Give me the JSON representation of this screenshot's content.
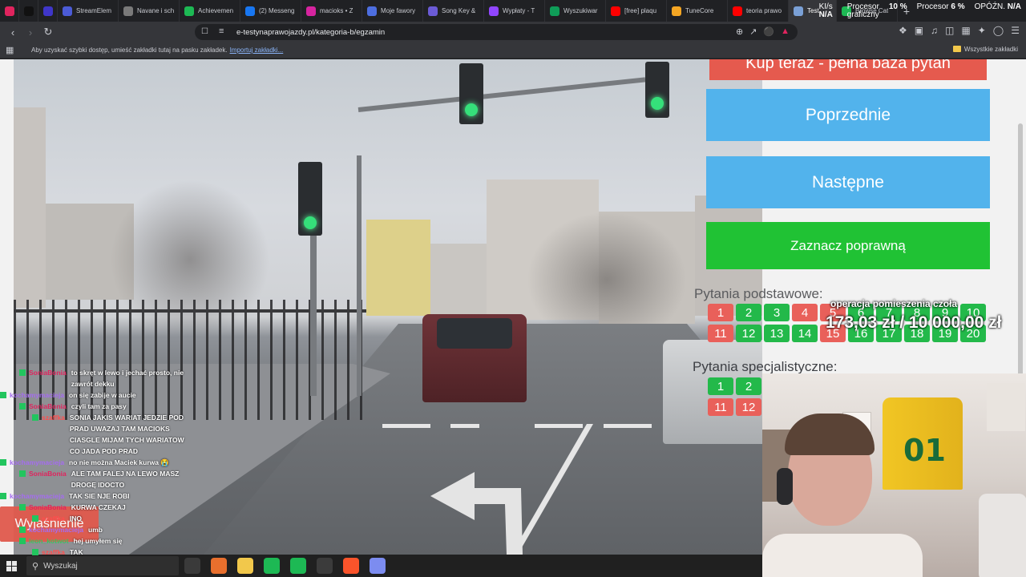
{
  "browser": {
    "tabs": [
      {
        "label": "",
        "icon": "app-red-icon",
        "color": "#e0245e",
        "pinned": true
      },
      {
        "label": "",
        "icon": "tiktok-icon",
        "color": "#111111",
        "pinned": true
      },
      {
        "label": "",
        "icon": "blue-square-icon",
        "color": "#3f36c9",
        "pinned": true
      },
      {
        "label": "StreamElem",
        "icon": "streamelements-icon",
        "color": "#4b5bd6"
      },
      {
        "label": "Navane i sch",
        "icon": "gear-icon",
        "color": "#7a7a7a"
      },
      {
        "label": "Achievemen",
        "icon": "k-logo-icon",
        "color": "#1db954"
      },
      {
        "label": "(2) Messeng",
        "icon": "facebook-icon",
        "color": "#1877f2"
      },
      {
        "label": "macioks • Z",
        "icon": "instagram-icon",
        "color": "#d6249f"
      },
      {
        "label": "Moje fawory",
        "icon": "bookmark-star-icon",
        "color": "#4d6ee0"
      },
      {
        "label": "Song Key &",
        "icon": "music-note-icon",
        "color": "#6b5bd6"
      },
      {
        "label": "Wypłaty - T",
        "icon": "twitch-icon",
        "color": "#9146ff"
      },
      {
        "label": "Wyszukiwar",
        "icon": "sheet-icon",
        "color": "#0f9d58"
      },
      {
        "label": "[free] plaqu",
        "icon": "youtube-icon",
        "color": "#ff0000"
      },
      {
        "label": "TuneCore",
        "icon": "tunecore-icon",
        "color": "#f5a623"
      },
      {
        "label": "teoria prawo",
        "icon": "youtube-icon",
        "color": "#ff0000"
      },
      {
        "label": "Test",
        "icon": "site-icon",
        "color": "#7aa0d6",
        "active": true
      },
      {
        "label": "Browse Cat",
        "icon": "k-logo-icon",
        "color": "#1db954"
      }
    ],
    "new_tab": "+",
    "hw": {
      "ki_label": "KI/s",
      "ki_value": "N/A",
      "gpu_label": "Procesor graficzny",
      "gpu_value": "10 %",
      "cpu_label": "Procesor",
      "cpu_value": "6 %",
      "lat_label": "OPÓŹN.",
      "lat_value": "N/A"
    },
    "url": "e-testynaprawojazdy.pl/kategoria-b/egzamin",
    "bookmarks_hint": "Aby uzyskać szybki dostęp, umieść zakładki tutaj na pasku zakładek.",
    "bookmarks_link": "Importuj zakładki...",
    "all_bookmarks": "Wszystkie zakładki"
  },
  "page": {
    "buy_label": "Kup teraz - pełna baza pytań",
    "prev_label": "Poprzednie",
    "next_label": "Następne",
    "mark_label": "Zaznacz poprawną",
    "basic_title": "Pytania podstawowe:",
    "basic_numbers": [
      {
        "n": "1",
        "status": "wrong"
      },
      {
        "n": "2",
        "status": "correct"
      },
      {
        "n": "3",
        "status": "correct"
      },
      {
        "n": "4",
        "status": "wrong"
      },
      {
        "n": "5",
        "status": "wrong"
      },
      {
        "n": "6",
        "status": "correct"
      },
      {
        "n": "7",
        "status": "correct"
      },
      {
        "n": "8",
        "status": "correct"
      },
      {
        "n": "9",
        "status": "correct"
      },
      {
        "n": "10",
        "status": "correct"
      },
      {
        "n": "11",
        "status": "wrong"
      },
      {
        "n": "12",
        "status": "correct"
      },
      {
        "n": "13",
        "status": "correct"
      },
      {
        "n": "14",
        "status": "correct"
      },
      {
        "n": "15",
        "status": "wrong"
      },
      {
        "n": "16",
        "status": "correct"
      },
      {
        "n": "17",
        "status": "correct"
      },
      {
        "n": "18",
        "status": "correct"
      },
      {
        "n": "19",
        "status": "correct"
      },
      {
        "n": "20",
        "status": "correct"
      }
    ],
    "special_title": "Pytania specjalistyczne:",
    "special_numbers": [
      {
        "n": "1",
        "status": "correct"
      },
      {
        "n": "2",
        "status": "correct"
      },
      {
        "n": "11",
        "status": "wrong"
      },
      {
        "n": "12",
        "status": "wrong"
      }
    ],
    "explain_label": "Wyjaśnienie"
  },
  "overlay": {
    "donation_title": "operacja pomieszenia czoła",
    "donation_amount": "173,03 zł / 10 000,00 zł",
    "chat": [
      {
        "user": "SoniaBonia",
        "color": "#e0245e",
        "msg": "to skręt w lewo i jechać prosto, nie\nzawrót dekku"
      },
      {
        "user": "kochamymacieja",
        "color": "#a56cf0",
        "msg": "on się zabije w aucie"
      },
      {
        "user": "SoniaBonia",
        "color": "#e0245e",
        "msg": "czyli tam za pasy"
      },
      {
        "user": "szaffka",
        "color": "#ff4d4d",
        "msg": "SONIA JAKIS WARIAT JEDZIE POD\nPRAD UWAZAJ TAM MACIOKS\nCIASGLE MIJAM TYCH WARIATOW\nCO JADA POD PRAD"
      },
      {
        "user": "kochamymacieja",
        "color": "#a56cf0",
        "msg": "no nie można Maciek kurwa 😭"
      },
      {
        "user": "SoniaBonia",
        "color": "#e0245e",
        "msg": "ALE TAM FALEJ NA LEWO MASZ\nDROGĘ IDOCTO"
      },
      {
        "user": "kochamymacieja",
        "color": "#a56cf0",
        "msg": "TAK SIE NJE ROBI"
      },
      {
        "user": "SoniaBonia",
        "color": "#e0245e",
        "msg": "KURWA CZEKAJ"
      },
      {
        "user": "szaffka",
        "color": "#ff4d4d",
        "msg": "INO"
      },
      {
        "user": "kochamymacieja",
        "color": "#a56cf0",
        "msg": "umb"
      },
      {
        "user": "leon_kotwot",
        "color": "#3fbf60",
        "msg": "hej umyłem się"
      },
      {
        "user": "szaffka",
        "color": "#ff4d4d",
        "msg": "TAK"
      }
    ]
  },
  "taskbar": {
    "search_placeholder": "Wyszukaj",
    "apps": [
      {
        "name": "task-view-icon",
        "color": "#3a3a3a"
      },
      {
        "name": "app-orange-icon",
        "color": "#e86f2d"
      },
      {
        "name": "folder-icon",
        "color": "#f2c84b"
      },
      {
        "name": "spotify-icon",
        "color": "#1db954"
      },
      {
        "name": "chat-app-icon",
        "color": "#1db954"
      },
      {
        "name": "obs-icon",
        "color": "#3b3b3b"
      },
      {
        "name": "brave-icon",
        "color": "#fb542b"
      },
      {
        "name": "pen-app-icon",
        "color": "#7c8cf0"
      }
    ]
  }
}
